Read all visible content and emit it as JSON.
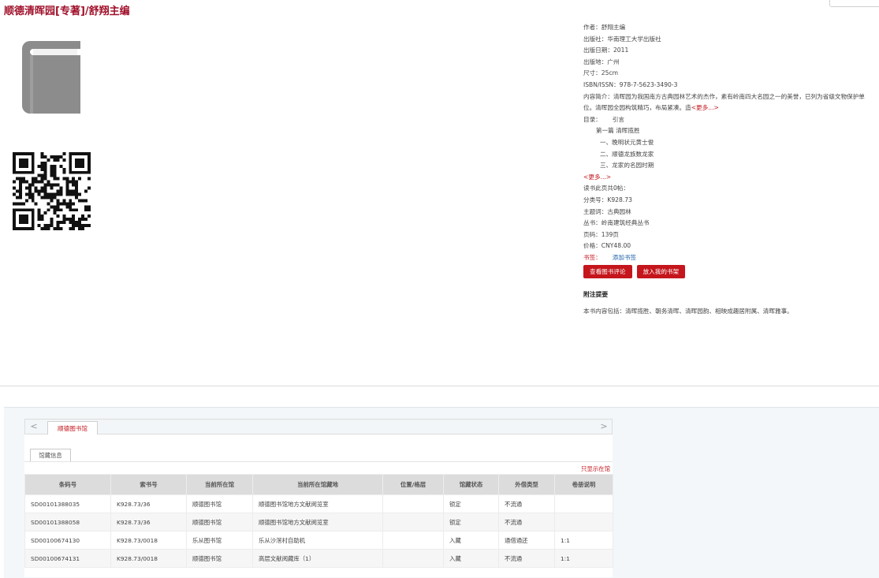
{
  "title": "顺德清晖园[专著]/舒翔主编",
  "meta": {
    "author": "作者：舒翔主编",
    "publisher": "出版社：华南理工大学出版社",
    "pub_date": "出版日期：2011",
    "pub_place": "出版地：广州",
    "size": "尺寸：25cm",
    "isbn": "ISBN/ISSN：978-7-5623-3490-3",
    "summary": "内容简介：清晖园为我国南方古典园林艺术的杰作，素有岭南四大名园之一的美誉，已列为省级文物保护单位。清晖园全园构筑精巧，布局紧凑。造",
    "more_label": "<更多...>",
    "toc_label": "目录：",
    "toc_lines": [
      "引言",
      "第一篇 清晖揽胜",
      "一、晚明状元黄士俊",
      "二、顺德龙族数龙家",
      "三、龙家的名园时期"
    ],
    "toc_more": "<更多...>",
    "reviews": "读书此页共0帖：",
    "classno": "分类号：K928.73",
    "subject": "主题词：古典园林",
    "series": "丛书：岭南建筑经典丛书",
    "pages": "页码：139页",
    "price": "价格：CNY48.00",
    "bookmark_label": "书签：",
    "bookmark_link": "添加书签"
  },
  "buttons": {
    "view_reviews": "查看图书评论",
    "add_shelf": "放入我的书架"
  },
  "notes": {
    "title": "附注提要",
    "text": "本书内容包括：清晖揽胜、朝务清晖、清晖园韵、相映成趣居附属、清晖雅事。"
  },
  "tabs": {
    "prev": "<",
    "next": ">",
    "active": "顺德图书馆",
    "sub": "馆藏信息"
  },
  "only_here": "只显示在馆",
  "holdings": {
    "columns": [
      "条码号",
      "索书号",
      "当前所在馆",
      "当前所在馆藏地",
      "位置/格层",
      "馆藏状态",
      "外借类型",
      "卷册说明"
    ],
    "rows": [
      [
        "SD00101388035",
        "K928.73/36",
        "顺德图书馆",
        "顺德图书馆地方文献阅览室",
        "",
        "锁定",
        "不流通",
        ""
      ],
      [
        "SD00101388058",
        "K928.73/36",
        "顺德图书馆",
        "顺德图书馆地方文献阅览室",
        "",
        "锁定",
        "不流通",
        ""
      ],
      [
        "SD00100674130",
        "K928.73/0018",
        "乐从图书馆",
        "乐从沙滘村自助机",
        "",
        "入藏",
        "通借通还",
        "1:1"
      ],
      [
        "SD00100674131",
        "K928.73/0018",
        "顺德图书馆",
        "高层文献阅藏库（1）",
        "",
        "入藏",
        "不流通",
        "1:1"
      ]
    ]
  },
  "colors": {
    "accent": "#c4161c",
    "title": "#a0102a",
    "link_blue": "#1b5fa8",
    "header_bg": "#dcdcdc"
  },
  "icons": {
    "cover": "book-icon",
    "qr": "qr-code"
  }
}
